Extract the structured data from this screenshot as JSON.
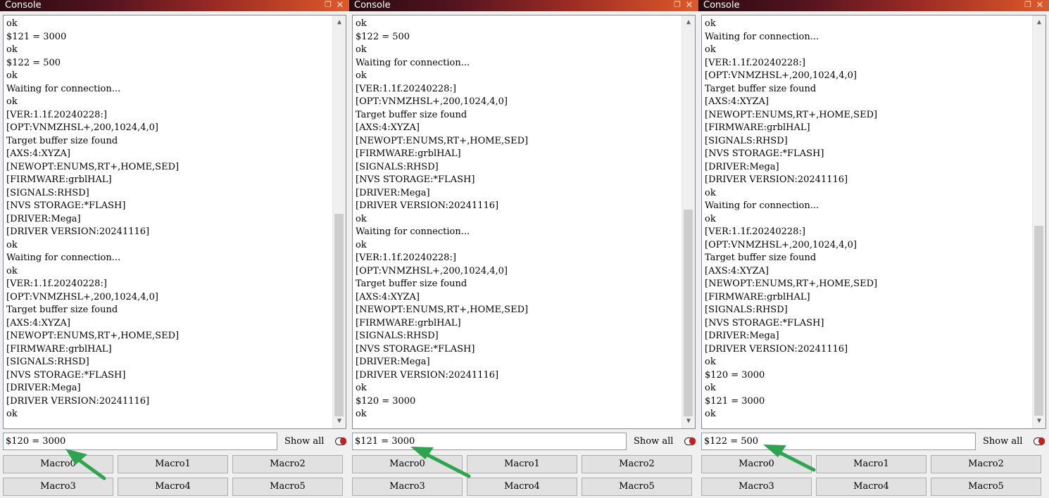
{
  "colors": {
    "titlebar_gradient": [
      "#2b0b12",
      "#9b2a24",
      "#dd5a2a"
    ],
    "arrow": "#2ea44f",
    "toggle_knob": "#c81e1e"
  },
  "icons": {
    "float": "float-window-icon",
    "close": "close-icon",
    "scroll_up": "chevron-up-icon",
    "scroll_down": "chevron-down-icon"
  },
  "panels": [
    {
      "title": "Console",
      "scroll_thumb": {
        "start": 0.48,
        "end": 0.97
      },
      "log": [
        "ok",
        "$121 = 3000",
        "ok",
        "$122 = 500",
        "ok",
        "Waiting for connection...",
        "ok",
        "[VER:1.1f.20240228:]",
        "[OPT:VNMZHSL+,200,1024,4,0]",
        "Target buffer size found",
        "[AXS:4:XYZA]",
        "[NEWOPT:ENUMS,RT+,HOME,SED]",
        "[FIRMWARE:grblHAL]",
        "[SIGNALS:RHSD]",
        "[NVS STORAGE:*FLASH]",
        "[DRIVER:Mega]",
        "[DRIVER VERSION:20241116]",
        "ok",
        "Waiting for connection...",
        "ok",
        "[VER:1.1f.20240228:]",
        "[OPT:VNMZHSL+,200,1024,4,0]",
        "Target buffer size found",
        "[AXS:4:XYZA]",
        "[NEWOPT:ENUMS,RT+,HOME,SED]",
        "[FIRMWARE:grblHAL]",
        "[SIGNALS:RHSD]",
        "[NVS STORAGE:*FLASH]",
        "[DRIVER:Mega]",
        "[DRIVER VERSION:20241116]",
        "ok"
      ],
      "input_value": "$120 = 3000",
      "show_all_label": "Show all",
      "macros": [
        "Macro0",
        "Macro1",
        "Macro2",
        "Macro3",
        "Macro4",
        "Macro5"
      ]
    },
    {
      "title": "Console",
      "scroll_thumb": {
        "start": 0.47,
        "end": 0.97
      },
      "log": [
        "ok",
        "$122 = 500",
        "ok",
        "Waiting for connection...",
        "ok",
        "[VER:1.1f.20240228:]",
        "[OPT:VNMZHSL+,200,1024,4,0]",
        "Target buffer size found",
        "[AXS:4:XYZA]",
        "[NEWOPT:ENUMS,RT+,HOME,SED]",
        "[FIRMWARE:grblHAL]",
        "[SIGNALS:RHSD]",
        "[NVS STORAGE:*FLASH]",
        "[DRIVER:Mega]",
        "[DRIVER VERSION:20241116]",
        "ok",
        "Waiting for connection...",
        "ok",
        "[VER:1.1f.20240228:]",
        "[OPT:VNMZHSL+,200,1024,4,0]",
        "Target buffer size found",
        "[AXS:4:XYZA]",
        "[NEWOPT:ENUMS,RT+,HOME,SED]",
        "[FIRMWARE:grblHAL]",
        "[SIGNALS:RHSD]",
        "[NVS STORAGE:*FLASH]",
        "[DRIVER:Mega]",
        "[DRIVER VERSION:20241116]",
        "ok",
        "$120 = 3000",
        "ok"
      ],
      "input_value": "$121 = 3000",
      "show_all_label": "Show all",
      "macros": [
        "Macro0",
        "Macro1",
        "Macro2",
        "Macro3",
        "Macro4",
        "Macro5"
      ]
    },
    {
      "title": "Console",
      "scroll_thumb": {
        "start": 0.51,
        "end": 0.97
      },
      "log": [
        "ok",
        "Waiting for connection...",
        "ok",
        "[VER:1.1f.20240228:]",
        "[OPT:VNMZHSL+,200,1024,4,0]",
        "Target buffer size found",
        "[AXS:4:XYZA]",
        "[NEWOPT:ENUMS,RT+,HOME,SED]",
        "[FIRMWARE:grblHAL]",
        "[SIGNALS:RHSD]",
        "[NVS STORAGE:*FLASH]",
        "[DRIVER:Mega]",
        "[DRIVER VERSION:20241116]",
        "ok",
        "Waiting for connection...",
        "ok",
        "[VER:1.1f.20240228:]",
        "[OPT:VNMZHSL+,200,1024,4,0]",
        "Target buffer size found",
        "[AXS:4:XYZA]",
        "[NEWOPT:ENUMS,RT+,HOME,SED]",
        "[FIRMWARE:grblHAL]",
        "[SIGNALS:RHSD]",
        "[NVS STORAGE:*FLASH]",
        "[DRIVER:Mega]",
        "[DRIVER VERSION:20241116]",
        "ok",
        "$120 = 3000",
        "ok",
        "$121 = 3000",
        "ok"
      ],
      "input_value": "$122 = 500",
      "show_all_label": "Show all",
      "macros": [
        "Macro0",
        "Macro1",
        "Macro2",
        "Macro3",
        "Macro4",
        "Macro5"
      ]
    }
  ]
}
